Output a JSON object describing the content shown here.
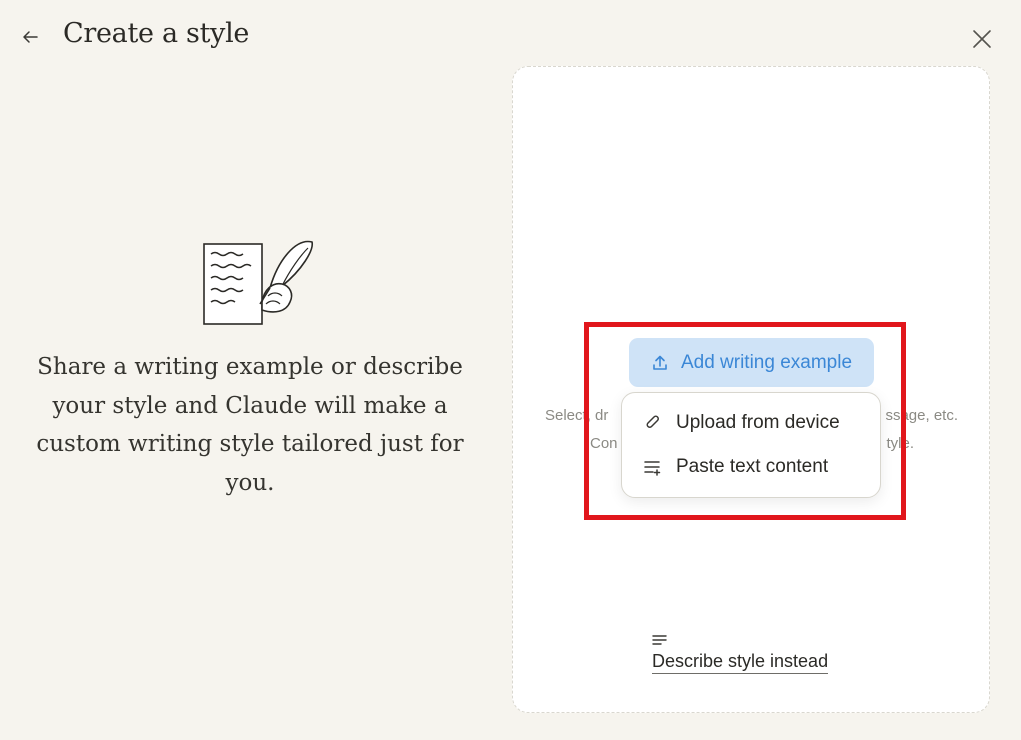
{
  "header": {
    "title": "Create a style",
    "back_icon": "arrow-left-icon",
    "close_icon": "close-icon"
  },
  "intro": {
    "illustration": "writing-quill-illustration",
    "description": "Share a writing example or describe your style and Claude will make a custom writing style tailored just for you."
  },
  "card": {
    "add_button_label": "Add writing example",
    "add_button_icon": "upload-icon",
    "hint_line1_left": "Select, dr",
    "hint_line1_right": "ssage, etc.",
    "hint_line2_left": "Con",
    "hint_line2_right": "tyle.",
    "menu": [
      {
        "label": "Upload from device",
        "icon": "paperclip-icon"
      },
      {
        "label": "Paste text content",
        "icon": "paste-text-icon"
      }
    ],
    "describe_label": "Describe style instead",
    "describe_icon": "text-lines-icon"
  },
  "colors": {
    "background": "#f6f4ee",
    "accent": "#3b87d6",
    "accent_bg": "#cfe3f7",
    "highlight": "#e1161c"
  }
}
